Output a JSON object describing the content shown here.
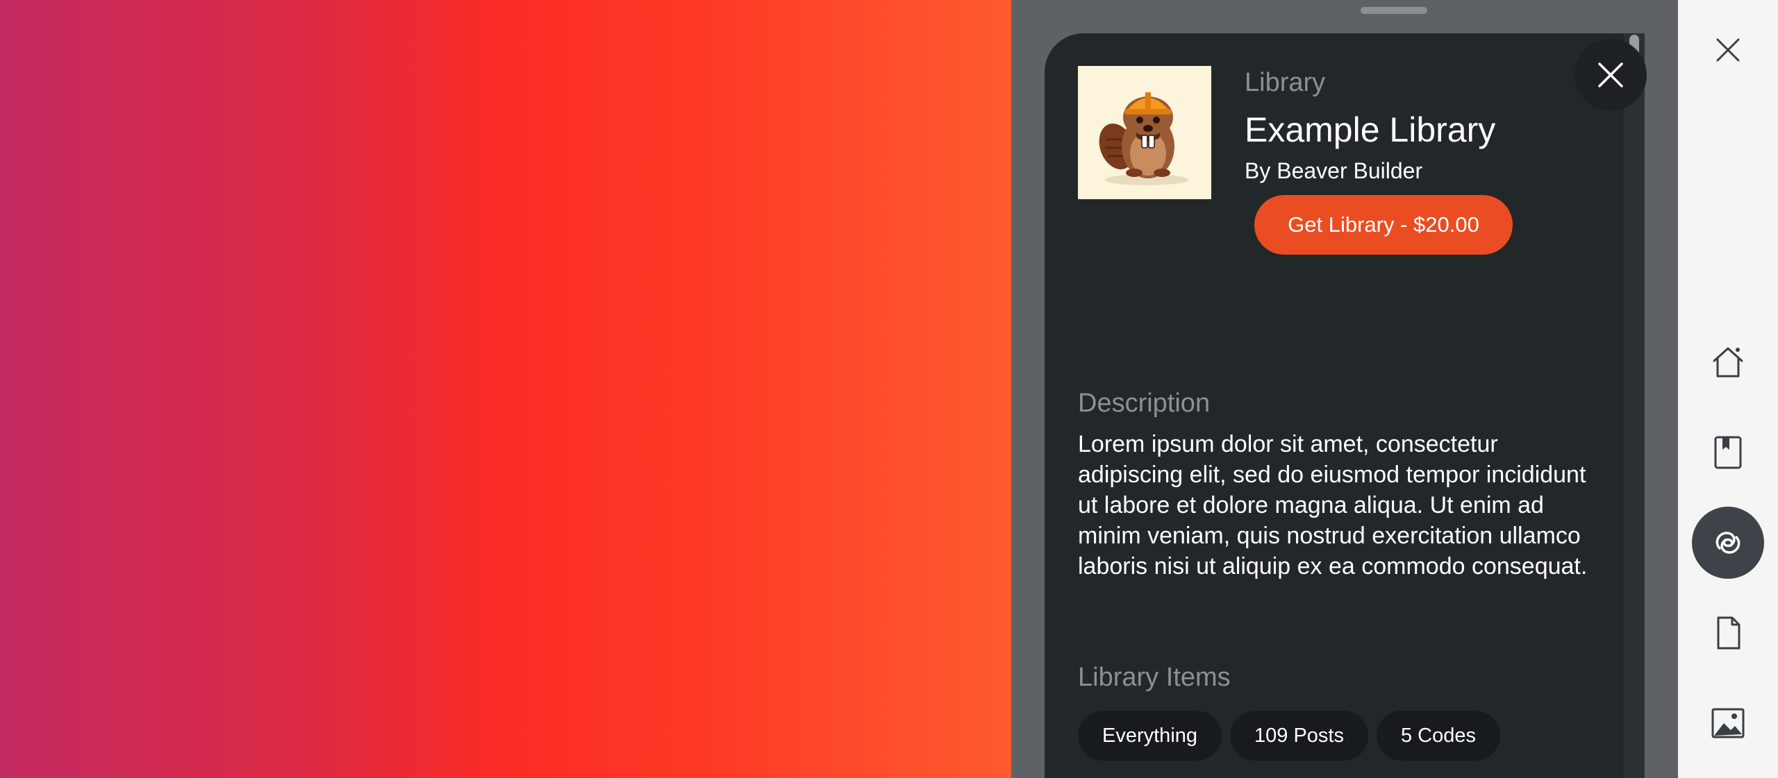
{
  "library": {
    "type_label": "Library",
    "title": "Example Library",
    "author": "By Beaver Builder",
    "buy_button": "Get Library - $20.00"
  },
  "description": {
    "heading": "Description",
    "text": "Lorem ipsum dolor sit amet, consectetur adipiscing elit, sed do eiusmod tempor incididunt ut labore et dolore magna aliqua. Ut enim ad minim veniam, quis nostrud exercitation ullamco laboris nisi ut aliquip ex ea commodo consequat."
  },
  "items": {
    "heading": "Library Items",
    "chips": [
      "Everything",
      "109 Posts",
      "5 Codes"
    ]
  },
  "sidebar": {
    "buttons": [
      {
        "icon": "home-icon"
      },
      {
        "icon": "bookmark-icon"
      },
      {
        "icon": "libraries-icon",
        "active": true
      },
      {
        "icon": "document-icon"
      },
      {
        "icon": "image-icon"
      }
    ]
  },
  "colors": {
    "accent": "#ea4d22",
    "card": "#22272a",
    "rail_active": "#3d4348"
  }
}
